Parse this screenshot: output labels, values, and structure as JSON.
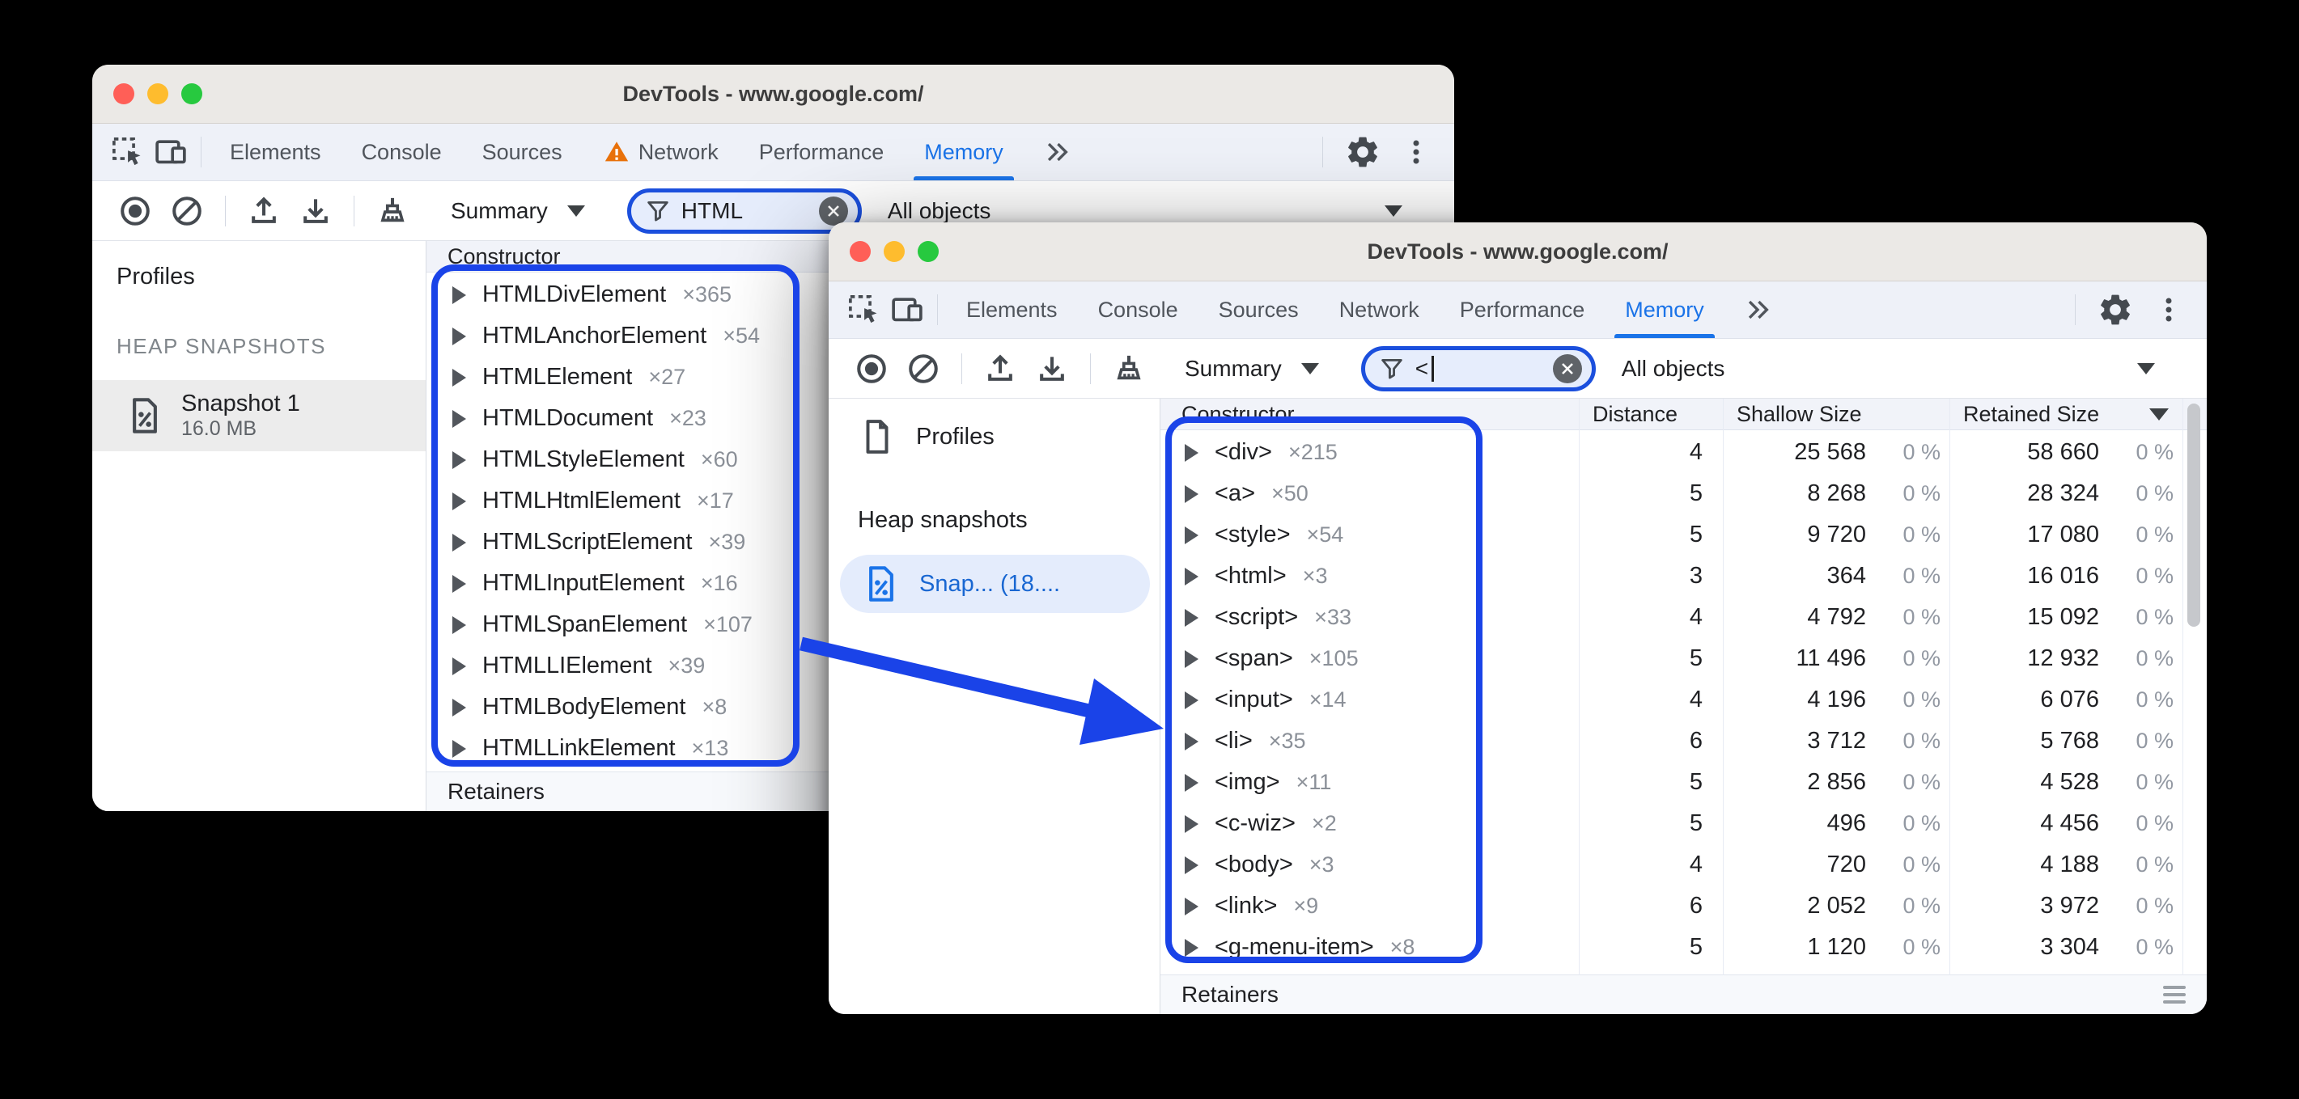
{
  "annotation": {
    "highlight_color": "#1a43e8"
  },
  "back_window": {
    "title": "DevTools - www.google.com/",
    "tabs": [
      "Elements",
      "Console",
      "Sources",
      "Network",
      "Performance",
      "Memory"
    ],
    "more_tabs": "»",
    "toolbar": {
      "perspective": "Summary",
      "filter_value": "HTML",
      "class_filter": "All objects"
    },
    "sidebar": {
      "profiles": "Profiles",
      "section": "HEAP SNAPSHOTS",
      "snapshot_name": "Snapshot 1",
      "snapshot_size": "16.0 MB"
    },
    "grid": {
      "constructor_header": "Constructor",
      "retainers": "Retainers",
      "rows": [
        {
          "name": "HTMLDivElement",
          "count": "×365"
        },
        {
          "name": "HTMLAnchorElement",
          "count": "×54"
        },
        {
          "name": "HTMLElement",
          "count": "×27"
        },
        {
          "name": "HTMLDocument",
          "count": "×23"
        },
        {
          "name": "HTMLStyleElement",
          "count": "×60"
        },
        {
          "name": "HTMLHtmlElement",
          "count": "×17"
        },
        {
          "name": "HTMLScriptElement",
          "count": "×39"
        },
        {
          "name": "HTMLInputElement",
          "count": "×16"
        },
        {
          "name": "HTMLSpanElement",
          "count": "×107"
        },
        {
          "name": "HTMLLIElement",
          "count": "×39"
        },
        {
          "name": "HTMLBodyElement",
          "count": "×8"
        },
        {
          "name": "HTMLLinkElement",
          "count": "×13"
        }
      ]
    }
  },
  "front_window": {
    "title": "DevTools - www.google.com/",
    "tabs": [
      "Elements",
      "Console",
      "Sources",
      "Network",
      "Performance",
      "Memory"
    ],
    "more_tabs": "»",
    "toolbar": {
      "perspective": "Summary",
      "filter_value": "<",
      "class_filter": "All objects"
    },
    "sidebar": {
      "profiles": "Profiles",
      "section": "Heap snapshots",
      "snapshot_label": "Snap... (18...."
    },
    "grid": {
      "headers": {
        "constructor": "Constructor",
        "distance": "Distance",
        "shallow": "Shallow Size",
        "retained": "Retained Size"
      },
      "retainers": "Retainers",
      "rows": [
        {
          "name": "<div>",
          "count": "×215",
          "distance": "4",
          "shallow": "25 568",
          "shallow_pct": "0 %",
          "retained": "58 660",
          "retained_pct": "0 %"
        },
        {
          "name": "<a>",
          "count": "×50",
          "distance": "5",
          "shallow": "8 268",
          "shallow_pct": "0 %",
          "retained": "28 324",
          "retained_pct": "0 %"
        },
        {
          "name": "<style>",
          "count": "×54",
          "distance": "5",
          "shallow": "9 720",
          "shallow_pct": "0 %",
          "retained": "17 080",
          "retained_pct": "0 %"
        },
        {
          "name": "<html>",
          "count": "×3",
          "distance": "3",
          "shallow": "364",
          "shallow_pct": "0 %",
          "retained": "16 016",
          "retained_pct": "0 %"
        },
        {
          "name": "<script>",
          "count": "×33",
          "distance": "4",
          "shallow": "4 792",
          "shallow_pct": "0 %",
          "retained": "15 092",
          "retained_pct": "0 %"
        },
        {
          "name": "<span>",
          "count": "×105",
          "distance": "5",
          "shallow": "11 496",
          "shallow_pct": "0 %",
          "retained": "12 932",
          "retained_pct": "0 %"
        },
        {
          "name": "<input>",
          "count": "×14",
          "distance": "4",
          "shallow": "4 196",
          "shallow_pct": "0 %",
          "retained": "6 076",
          "retained_pct": "0 %"
        },
        {
          "name": "<li>",
          "count": "×35",
          "distance": "6",
          "shallow": "3 712",
          "shallow_pct": "0 %",
          "retained": "5 768",
          "retained_pct": "0 %"
        },
        {
          "name": "<img>",
          "count": "×11",
          "distance": "5",
          "shallow": "2 856",
          "shallow_pct": "0 %",
          "retained": "4 528",
          "retained_pct": "0 %"
        },
        {
          "name": "<c-wiz>",
          "count": "×2",
          "distance": "5",
          "shallow": "496",
          "shallow_pct": "0 %",
          "retained": "4 456",
          "retained_pct": "0 %"
        },
        {
          "name": "<body>",
          "count": "×3",
          "distance": "4",
          "shallow": "720",
          "shallow_pct": "0 %",
          "retained": "4 188",
          "retained_pct": "0 %"
        },
        {
          "name": "<link>",
          "count": "×9",
          "distance": "6",
          "shallow": "2 052",
          "shallow_pct": "0 %",
          "retained": "3 972",
          "retained_pct": "0 %"
        },
        {
          "name": "<g-menu-item>",
          "count": "×8",
          "distance": "5",
          "shallow": "1 120",
          "shallow_pct": "0 %",
          "retained": "3 304",
          "retained_pct": "0 %"
        }
      ]
    }
  }
}
